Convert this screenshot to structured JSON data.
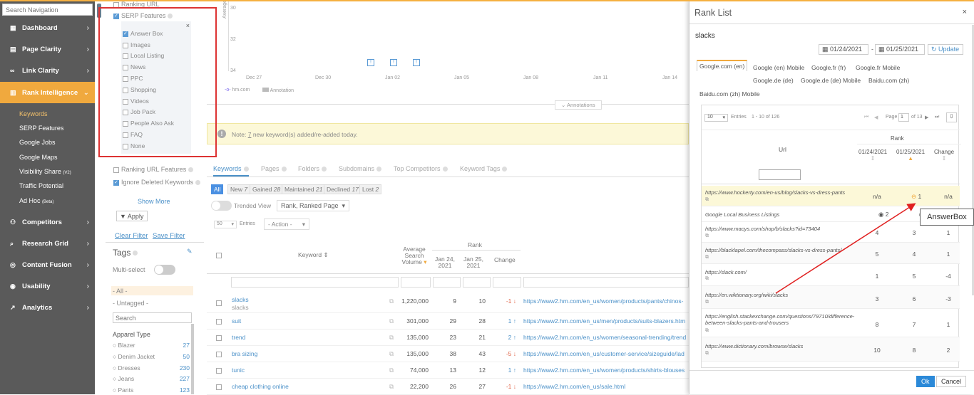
{
  "nav": {
    "search_placeholder": "Search Navigation",
    "items": [
      {
        "label": "Dashboard",
        "icon": "dashboard-icon"
      },
      {
        "label": "Page Clarity",
        "icon": "page-icon"
      },
      {
        "label": "Link Clarity",
        "icon": "link-icon"
      },
      {
        "label": "Rank Intelligence",
        "icon": "rank-icon"
      },
      {
        "label": "Competitors",
        "icon": "competitors-icon"
      },
      {
        "label": "Research Grid",
        "icon": "search-icon"
      },
      {
        "label": "Content Fusion",
        "icon": "content-icon"
      },
      {
        "label": "Usability",
        "icon": "usability-icon"
      },
      {
        "label": "Analytics",
        "icon": "analytics-icon"
      }
    ],
    "sub": [
      "Keywords",
      "SERP Features",
      "Google Jobs",
      "Google Maps",
      "Visibility Share",
      "Traffic Potential",
      "Ad Hoc"
    ],
    "sub_badges": {
      "visibility": "(V2)",
      "adhoc": "(Beta)"
    }
  },
  "filters": {
    "ranking_url": "Ranking URL",
    "serp_features": "SERP Features",
    "serp_options": [
      "Answer Box",
      "Images",
      "Local Listing",
      "News",
      "PPC",
      "Shopping",
      "Videos",
      "Job Pack",
      "People Also Ask",
      "FAQ",
      "None"
    ],
    "ranking_url_features": "Ranking URL Features",
    "ignore_deleted": "Ignore Deleted Keywords",
    "show_more": "Show More",
    "apply": "Apply",
    "clear_filter": "Clear Filter",
    "save_filter": "Save Filter",
    "tags_title": "Tags",
    "multi_select": "Multi-select",
    "all": "- All -",
    "untagged": "- Untagged -",
    "tag_search_placeholder": "Search",
    "group": "Apparel Type",
    "tags": [
      {
        "name": "Blazer",
        "count": "27"
      },
      {
        "name": "Denim Jacket",
        "count": "50"
      },
      {
        "name": "Dresses",
        "count": "230"
      },
      {
        "name": "Jeans",
        "count": "227"
      },
      {
        "name": "Pants",
        "count": "123"
      }
    ]
  },
  "chart": {
    "yticks": [
      "30",
      "32",
      "34"
    ],
    "yaxis": "Average",
    "xticks": [
      "Dec 27",
      "Dec 30",
      "Jan 02",
      "Jan 05",
      "Jan 08",
      "Jan 11",
      "Jan 14"
    ],
    "legend_series": "hm.com",
    "legend_annotation": "Annotation",
    "annotations_button": "Annotations"
  },
  "note": {
    "prefix": "Note:",
    "count": "7",
    "text": "new keyword(s) added/re-added today."
  },
  "tabs": [
    "Keywords",
    "Pages",
    "Folders",
    "Subdomains",
    "Top Competitors",
    "Keyword Tags"
  ],
  "pills": [
    {
      "label": "All",
      "count": ""
    },
    {
      "label": "New",
      "count": "7"
    },
    {
      "label": "Gained",
      "count": "28"
    },
    {
      "label": "Maintained",
      "count": "21"
    },
    {
      "label": "Declined",
      "count": "17"
    },
    {
      "label": "Lost",
      "count": "2"
    }
  ],
  "trended_view": "Trended View",
  "view_select": "Rank, Ranked Page",
  "entries_select": "50",
  "entries_label": "Entries",
  "action_select": "- Action -",
  "table_headers": {
    "keyword": "Keyword",
    "volume": "Average Search Volume",
    "rank": "Rank",
    "date1": "Jan 24, 2021",
    "date2": "Jan 25, 2021",
    "change": "Change"
  },
  "rows": [
    {
      "kw": "slacks",
      "sub": "slacks",
      "vol": "1,220,000",
      "r1": "9",
      "r2": "10",
      "chg": "-1",
      "dir": "down",
      "url": "https://www2.hm.com/en_us/women/products/pants/chinos-"
    },
    {
      "kw": "suit",
      "sub": "",
      "vol": "301,000",
      "r1": "29",
      "r2": "28",
      "chg": "1",
      "dir": "up",
      "url": "https://www2.hm.com/en_us/men/products/suits-blazers.htm"
    },
    {
      "kw": "trend",
      "sub": "",
      "vol": "135,000",
      "r1": "23",
      "r2": "21",
      "chg": "2",
      "dir": "up",
      "url": "https://www2.hm.com/en_us/women/seasonal-trending/trend"
    },
    {
      "kw": "bra sizing",
      "sub": "",
      "vol": "135,000",
      "r1": "38",
      "r2": "43",
      "chg": "-5",
      "dir": "down",
      "url": "https://www2.hm.com/en_us/customer-service/sizeguide/lad"
    },
    {
      "kw": "tunic",
      "sub": "",
      "vol": "74,000",
      "r1": "13",
      "r2": "12",
      "chg": "1",
      "dir": "up",
      "url": "https://www2.hm.com/en_us/women/products/shirts-blouses"
    },
    {
      "kw": "cheap clothing online",
      "sub": "",
      "vol": "22,200",
      "r1": "26",
      "r2": "27",
      "chg": "-1",
      "dir": "down",
      "url": "https://www2.hm.com/en_us/sale.html"
    }
  ],
  "modal": {
    "title": "Rank List",
    "close": "×",
    "keyword": "slacks",
    "date_from": "01/24/2021",
    "date_to": "01/25/2021",
    "dash": "-",
    "update": "Update",
    "engines": [
      "Google.com (en)",
      "Google (en) Mobile",
      "Google.fr (fr)",
      "Google.fr Mobile",
      "Google.de (de)",
      "Google.de (de) Mobile",
      "Baidu.com (zh)",
      "Baidu.com (zh) Mobile"
    ],
    "entries": "10",
    "entries_label": "Entries",
    "entries_range": "1 - 10 of 126",
    "page_label": "Page",
    "page_value": "1",
    "page_of": "of 13",
    "col_url": "Url",
    "col_rank": "Rank",
    "col_d1": "01/24/2021",
    "col_d2": "01/25/2021",
    "col_change": "Change",
    "rows": [
      {
        "url": "https://www.hockerty.com/en-us/blog/slacks-vs-dress-pants",
        "r1": "n/a",
        "r2": "1",
        "chg": "n/a"
      },
      {
        "url": "Google Local Business Listings",
        "r1": "2",
        "r2": "",
        "chg": ""
      },
      {
        "url": "https://www.macys.com/shop/b/slacks?id=73404",
        "r1": "4",
        "r2": "3",
        "chg": "1"
      },
      {
        "url": "https://blacklapel.com/thecompass/slacks-vs-dress-pants/",
        "r1": "5",
        "r2": "4",
        "chg": "1"
      },
      {
        "url": "https://slack.com/",
        "r1": "1",
        "r2": "5",
        "chg": "-4"
      },
      {
        "url": "https://en.wiktionary.org/wiki/slacks",
        "r1": "3",
        "r2": "6",
        "chg": "-3"
      },
      {
        "url": "https://english.stackexchange.com/questions/79710/difference-between-slacks-pants-and-trousers",
        "r1": "8",
        "r2": "7",
        "chg": "1"
      },
      {
        "url": "https://www.dictionary.com/browse/slacks",
        "r1": "10",
        "r2": "8",
        "chg": "2"
      }
    ],
    "ok": "Ok",
    "cancel": "Cancel"
  },
  "callout": "AnswerBox",
  "colors": {
    "accent": "#f0a93e",
    "link": "#4a90c8",
    "nav_bg": "#5a5a5a",
    "highlight": "#f0a93e",
    "annotation_red": "#d33"
  }
}
